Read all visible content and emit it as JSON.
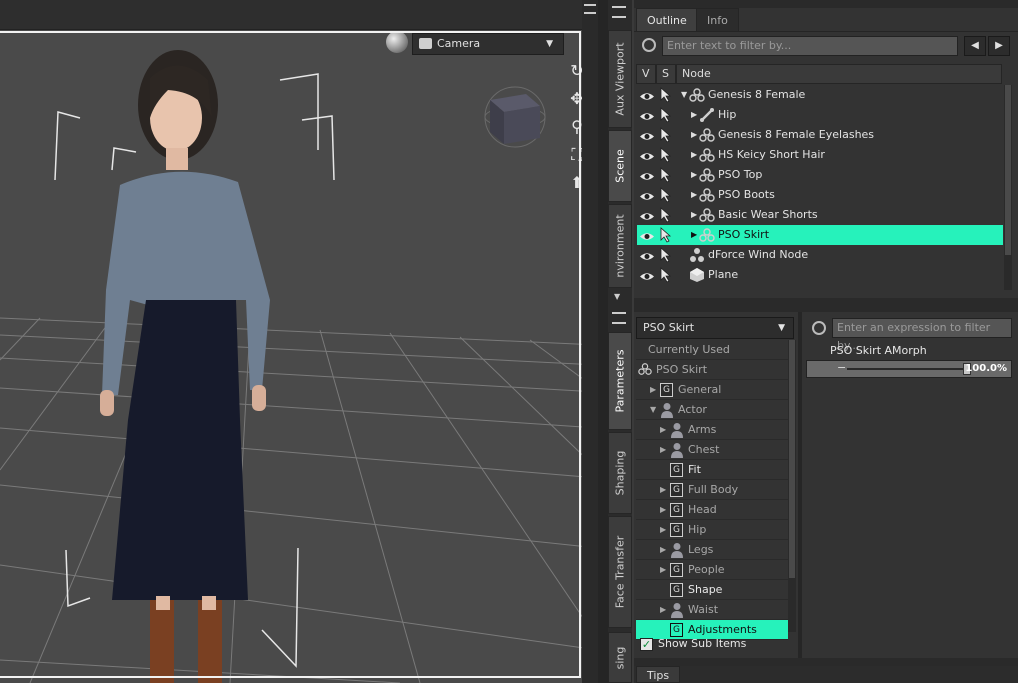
{
  "viewport": {
    "camera_label": "Camera",
    "icons": [
      "render-sphere-icon",
      "camera-icon",
      "rotate-icon",
      "move-icon",
      "zoom-icon",
      "frame-icon",
      "reset-icon"
    ]
  },
  "side_tabs_left": [
    "Aux Viewport",
    "Scene",
    "nvironment"
  ],
  "side_tabs_left_bottom": [
    "Parameters",
    "Shaping",
    "Face Transfer",
    "sing"
  ],
  "outline": {
    "tabs": [
      "Outline",
      "Info"
    ],
    "filter_placeholder": "Enter text to filter by...",
    "columns": [
      "V",
      "S",
      "Node"
    ],
    "rows": [
      {
        "label": "Genesis 8 Female",
        "indent": 0,
        "expand": true,
        "icon": "figure-icon",
        "selected": false
      },
      {
        "label": "Hip",
        "indent": 1,
        "expand": true,
        "icon": "bone-icon",
        "selected": false
      },
      {
        "label": "Genesis 8 Female Eyelashes",
        "indent": 1,
        "expand": true,
        "icon": "figure-icon",
        "selected": false
      },
      {
        "label": "HS Keicy Short Hair",
        "indent": 1,
        "expand": true,
        "icon": "figure-icon",
        "selected": false
      },
      {
        "label": "PSO Top",
        "indent": 1,
        "expand": true,
        "icon": "figure-icon",
        "selected": false
      },
      {
        "label": "PSO Boots",
        "indent": 1,
        "expand": true,
        "icon": "figure-icon",
        "selected": false
      },
      {
        "label": "Basic Wear Shorts",
        "indent": 1,
        "expand": true,
        "icon": "figure-icon",
        "selected": false
      },
      {
        "label": "PSO Skirt",
        "indent": 1,
        "expand": true,
        "icon": "figure-icon",
        "selected": true
      },
      {
        "label": "dForce Wind Node",
        "indent": 0,
        "expand": false,
        "icon": "wind-node-icon",
        "selected": false
      },
      {
        "label": "Plane",
        "indent": 0,
        "expand": false,
        "icon": "plane-icon",
        "selected": false
      }
    ]
  },
  "parameters": {
    "node_select": "PSO Skirt",
    "expr_placeholder": "Enter an expression to filter by...",
    "tree": [
      {
        "label": "Currently Used",
        "type": "none",
        "indent": 0,
        "expand": "",
        "bright": false,
        "selected": false
      },
      {
        "label": "PSO Skirt",
        "type": "figure",
        "indent": 0,
        "expand": "",
        "bright": false,
        "selected": false
      },
      {
        "label": "General",
        "type": "group",
        "indent": 1,
        "expand": "▶",
        "bright": false,
        "selected": false
      },
      {
        "label": "Actor",
        "type": "person",
        "indent": 1,
        "expand": "▼",
        "bright": false,
        "selected": false
      },
      {
        "label": "Arms",
        "type": "person",
        "indent": 2,
        "expand": "▶",
        "bright": false,
        "selected": false
      },
      {
        "label": "Chest",
        "type": "person",
        "indent": 2,
        "expand": "▶",
        "bright": false,
        "selected": false
      },
      {
        "label": "Fit",
        "type": "group",
        "indent": 2,
        "expand": "",
        "bright": true,
        "selected": false
      },
      {
        "label": "Full Body",
        "type": "group",
        "indent": 2,
        "expand": "▶",
        "bright": false,
        "selected": false
      },
      {
        "label": "Head",
        "type": "group",
        "indent": 2,
        "expand": "▶",
        "bright": false,
        "selected": false
      },
      {
        "label": "Hip",
        "type": "group",
        "indent": 2,
        "expand": "▶",
        "bright": false,
        "selected": false
      },
      {
        "label": "Legs",
        "type": "person",
        "indent": 2,
        "expand": "▶",
        "bright": false,
        "selected": false
      },
      {
        "label": "People",
        "type": "group",
        "indent": 2,
        "expand": "▶",
        "bright": false,
        "selected": false
      },
      {
        "label": "Shape",
        "type": "group",
        "indent": 2,
        "expand": "",
        "bright": true,
        "selected": false
      },
      {
        "label": "Waist",
        "type": "person",
        "indent": 2,
        "expand": "▶",
        "bright": false,
        "selected": false
      },
      {
        "label": "Adjustments",
        "type": "group",
        "indent": 2,
        "expand": "",
        "bright": false,
        "selected": true
      }
    ],
    "property_name": "PSO Skirt AMorph",
    "property_value": "100.0%",
    "property_fraction": 1.0,
    "show_sub_items": "Show Sub Items"
  },
  "tips_tab": "Tips",
  "colors": {
    "selection": "#26f2bb",
    "panel": "#333333",
    "viewport_bg": "#4a4a4a"
  }
}
